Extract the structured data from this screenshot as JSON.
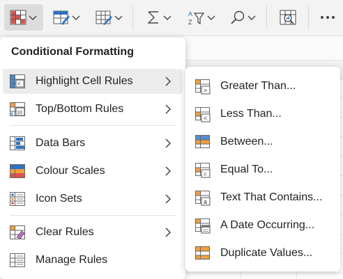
{
  "ribbon": {
    "buttons": [
      {
        "icon": "conditional-formatting-icon"
      },
      {
        "icon": "format-as-table-icon"
      },
      {
        "icon": "cell-styles-icon"
      },
      {
        "icon": "autosum-icon"
      },
      {
        "icon": "sort-filter-icon"
      },
      {
        "icon": "find-icon"
      },
      {
        "icon": "analyse-data-icon"
      },
      {
        "icon": "more-icon"
      }
    ]
  },
  "menu": {
    "title": "Conditional Formatting",
    "items": [
      {
        "label": "Highlight Cell Rules",
        "icon": "highlight-cell-rules-icon",
        "has_submenu": true
      },
      {
        "label": "Top/Bottom Rules",
        "icon": "top-bottom-rules-icon",
        "has_submenu": true
      },
      {
        "label": "Data Bars",
        "icon": "data-bars-icon",
        "has_submenu": true
      },
      {
        "label": "Colour Scales",
        "icon": "colour-scales-icon",
        "has_submenu": true
      },
      {
        "label": "Icon Sets",
        "icon": "icon-sets-icon",
        "has_submenu": true
      },
      {
        "label": "Clear Rules",
        "icon": "clear-rules-icon",
        "has_submenu": true
      },
      {
        "label": "Manage Rules",
        "icon": "manage-rules-icon",
        "has_submenu": false
      }
    ]
  },
  "submenu": {
    "items": [
      {
        "label": "Greater Than...",
        "icon": "greater-than-icon"
      },
      {
        "label": "Less Than...",
        "icon": "less-than-icon"
      },
      {
        "label": "Between...",
        "icon": "between-icon"
      },
      {
        "label": "Equal To...",
        "icon": "equal-to-icon"
      },
      {
        "label": "Text That Contains...",
        "icon": "text-contains-icon"
      },
      {
        "label": "A Date Occurring...",
        "icon": "date-occurring-icon"
      },
      {
        "label": "Duplicate Values...",
        "icon": "duplicate-values-icon"
      }
    ]
  },
  "colors": {
    "accent_orange": "#f0a040",
    "accent_blue": "#2b72c6",
    "accent_red": "#d9534f",
    "hover_bg": "#ececec"
  }
}
